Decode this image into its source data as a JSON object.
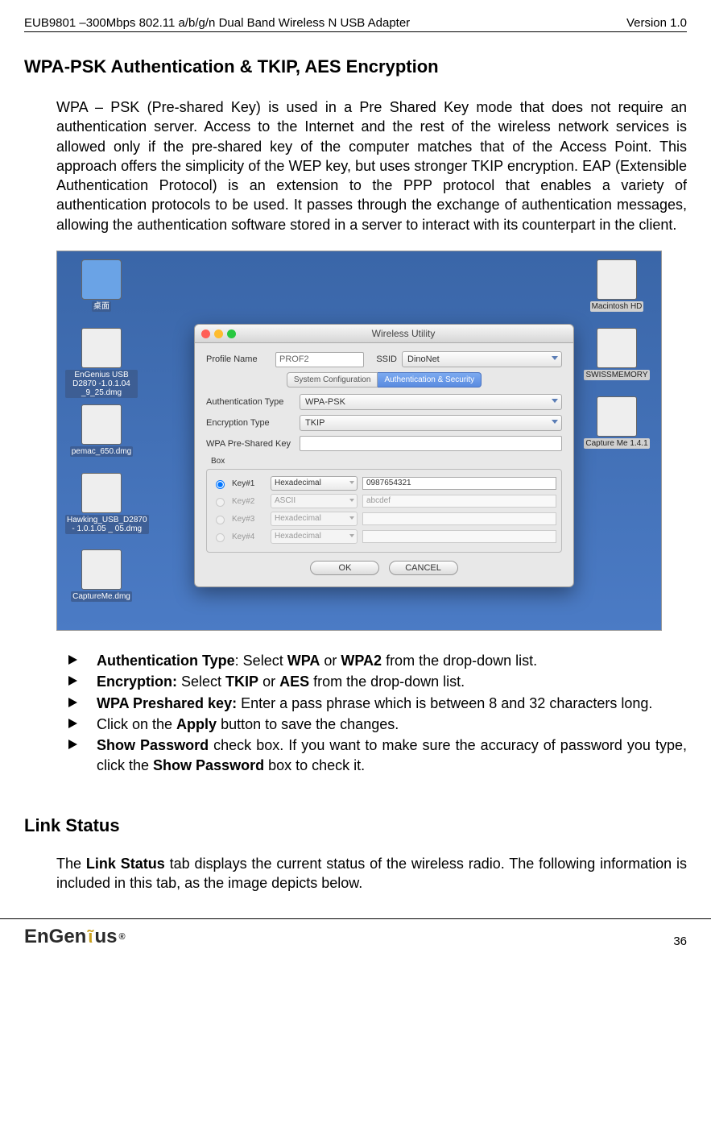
{
  "header": {
    "left": "EUB9801 –300Mbps 802.11 a/b/g/n Dual Band Wireless N USB Adapter",
    "right": "Version 1.0"
  },
  "section1": {
    "title": "WPA-PSK Authentication & TKIP, AES Encryption",
    "para": "WPA – PSK (Pre-shared Key) is used in a Pre Shared Key mode that does not require an authentication server.  Access to the Internet and the rest of the wireless network services is allowed only if the pre-shared key of the computer matches that of the Access Point.  This approach offers the simplicity of the WEP key, but uses stronger TKIP encryption. EAP (Extensible Authentication Protocol) is an extension to the PPP protocol that enables a variety of authentication protocols to be used. It passes through the exchange of authentication messages, allowing the authentication software stored in a server to interact with its counterpart in the client."
  },
  "screenshot": {
    "desktop_left": [
      {
        "label": "桌面"
      },
      {
        "label": "EnGenius USB D2870 -1.0.1.04 _9_25.dmg"
      },
      {
        "label": "pemac_650.dmg"
      },
      {
        "label": "Hawking_USB_D2870 - 1.0.1.05 _ 05.dmg"
      },
      {
        "label": "CaptureMe.dmg"
      }
    ],
    "desktop_right": [
      {
        "label": "Macintosh HD"
      },
      {
        "label": "SWISSMEMORY"
      },
      {
        "label": "Capture Me 1.4.1"
      }
    ],
    "window": {
      "title": "Wireless Utility",
      "profile_label": "Profile Name",
      "profile_value": "PROF2",
      "ssid_label": "SSID",
      "ssid_value": "DinoNet",
      "tabs": [
        "System Configuration",
        "Authentication & Security"
      ],
      "auth_label": "Authentication Type",
      "auth_value": "WPA-PSK",
      "enc_label": "Encryption Type",
      "enc_value": "TKIP",
      "psk_label": "WPA Pre-Shared Key",
      "box_label": "Box",
      "keys": [
        {
          "name": "Key#1",
          "type": "Hexadecimal",
          "value": "0987654321"
        },
        {
          "name": "Key#2",
          "type": "ASCII",
          "value": "abcdef"
        },
        {
          "name": "Key#3",
          "type": "Hexadecimal",
          "value": ""
        },
        {
          "name": "Key#4",
          "type": "Hexadecimal",
          "value": ""
        }
      ],
      "ok": "OK",
      "cancel": "CANCEL"
    }
  },
  "bullets": {
    "b1a": "Authentication Type",
    "b1b": ": Select ",
    "b1c": "WPA",
    "b1d": " or ",
    "b1e": "WPA2",
    "b1f": " from the drop-down list.",
    "b2a": "Encryption:",
    "b2b": " Select ",
    "b2c": "TKIP",
    "b2d": " or ",
    "b2e": "AES",
    "b2f": " from the drop-down list.",
    "b3a": "WPA Preshared key:",
    "b3b": " Enter a pass phrase which is between 8 and 32 characters long.",
    "b4a": "Click on the ",
    "b4b": "Apply",
    "b4c": " button to save the changes.",
    "b5a": "Show Password",
    "b5b": " check box. If you want to make sure the accuracy of password you type, click the ",
    "b5c": "Show Password",
    "b5d": " box to check it."
  },
  "section2": {
    "title": "Link Status",
    "para_a": "The ",
    "para_b": "Link Status",
    "para_c": " tab displays the current status of the wireless radio.  The following information is included in this tab, as the image depicts below."
  },
  "footer": {
    "logo_text": "EnGen",
    "logo_text2": "us",
    "pagenum": "36"
  }
}
